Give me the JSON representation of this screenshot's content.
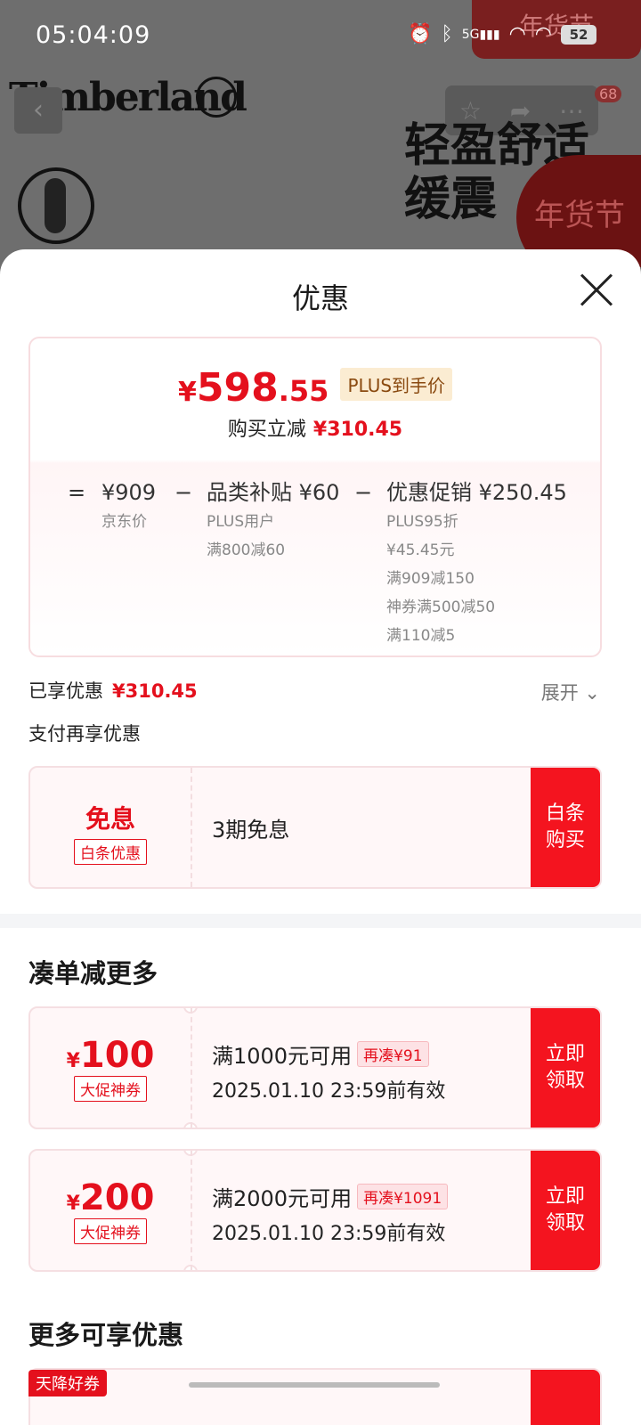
{
  "status": {
    "time": "05:04:09",
    "battery": "52",
    "network": "5G"
  },
  "background": {
    "brand_logo": "Timberland",
    "promo_line1": "轻盈舒适",
    "promo_line2": "缓震",
    "festival_tag": "年货节",
    "cart_badge": "68"
  },
  "sheet": {
    "title": "优惠",
    "price_card": {
      "yen": "¥",
      "price_int": "598",
      "price_dec": ".55",
      "plus_tag": "PLUS到手价",
      "reduce_label": "购买立减",
      "reduce_amount": "¥310.45",
      "eq": "=",
      "minus": "−",
      "jd_price": "¥909",
      "jd_price_label": "京东价",
      "subsidy_title": "品类补贴 ¥60",
      "subsidy_lines": [
        "PLUS用户",
        "满800减60"
      ],
      "promo_title": "优惠促销 ¥250.45",
      "promo_lines": [
        "PLUS95折",
        "¥45.45元",
        "满909减150",
        "神券满500减50",
        "满110减5"
      ]
    },
    "enjoyed_label": "已享优惠",
    "enjoyed_amount": "¥310.45",
    "expand_label": "展开",
    "pay_more_label": "支付再享优惠",
    "baitiao": {
      "left_title": "免息",
      "left_tag": "白条优惠",
      "desc": "3期免息",
      "button": "白条\n购买"
    },
    "section_more_off": "凑单减更多",
    "coupons": [
      {
        "yen": "¥",
        "amount": "100",
        "tag": "大促神券",
        "condition": "满1000元可用",
        "need": "再凑¥91",
        "expiry": "2025.01.10 23:59前有效",
        "button": "立即\n领取"
      },
      {
        "yen": "¥",
        "amount": "200",
        "tag": "大促神券",
        "condition": "满2000元可用",
        "need": "再凑¥1091",
        "expiry": "2025.01.10 23:59前有效",
        "button": "立即\n领取"
      }
    ],
    "section_more_enjoy": "更多可享优惠",
    "tianjiang_tag": "天降好券"
  },
  "colors": {
    "accent": "#e4101d",
    "button": "#f4141f",
    "card_bg": "#fff7f8"
  }
}
